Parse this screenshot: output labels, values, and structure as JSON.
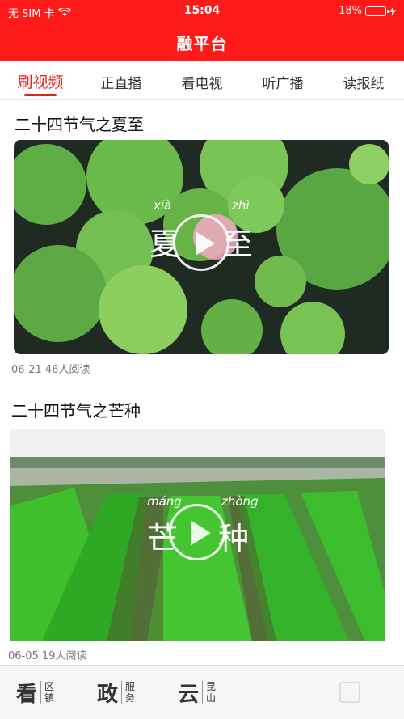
{
  "status_bar": {
    "carrier": "无 SIM 卡",
    "time": "15:04",
    "battery": "18%"
  },
  "app_title": "融平台",
  "tabs": [
    {
      "label": "刷视频",
      "active": true
    },
    {
      "label": "正直播",
      "active": false
    },
    {
      "label": "看电视",
      "active": false
    },
    {
      "label": "听广播",
      "active": false
    },
    {
      "label": "读报纸",
      "active": false
    }
  ],
  "articles": [
    {
      "title": "二十四节气之夏至",
      "meta": "06-21 46人阅读",
      "overlay": {
        "pinyin_left": "xià",
        "pinyin_right": "zhì",
        "char_left": "夏",
        "char_right": "至"
      }
    },
    {
      "title": "二十四节气之芒种",
      "meta": "06-05 19人阅读",
      "overlay": {
        "pinyin_left": "máng",
        "pinyin_right": "zhòng",
        "char_left": "芒",
        "char_right": "种"
      }
    }
  ],
  "bottom_nav": [
    {
      "big": "看",
      "small": "区镇"
    },
    {
      "big": "政",
      "small": "服务"
    },
    {
      "big": "云",
      "small": "昆山"
    },
    {
      "big": "",
      "small": ""
    },
    {
      "big": "",
      "small": ""
    }
  ],
  "colors": {
    "brand_red": "#ff1a1a",
    "tab_active": "#e2231a"
  }
}
